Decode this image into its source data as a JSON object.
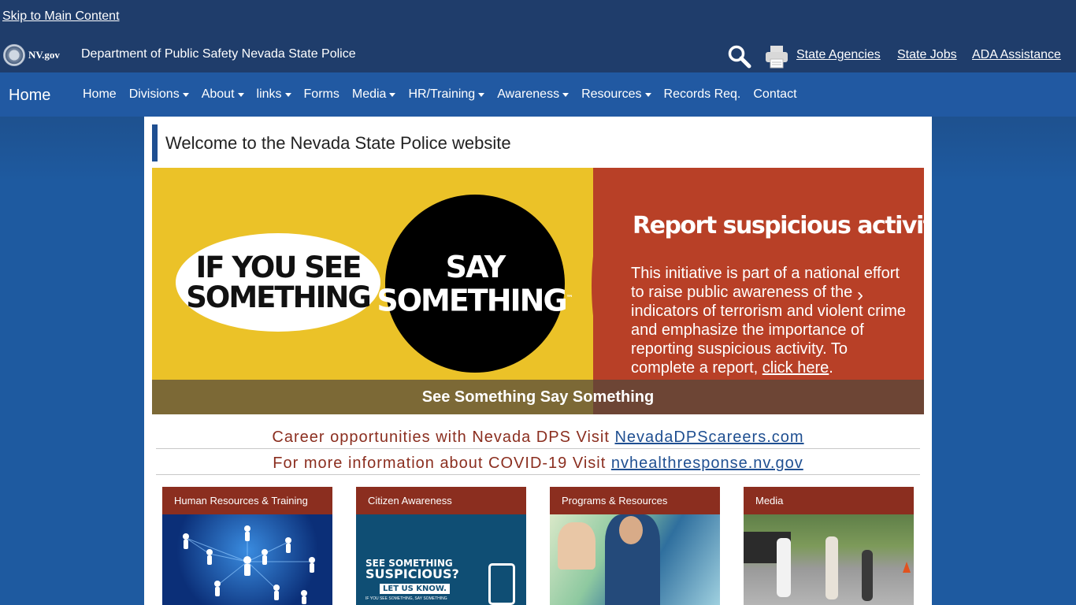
{
  "skip_link": "Skip to Main Content",
  "header": {
    "logo_text": "NV.gov",
    "department": "Department of Public Safety Nevada State Police",
    "links": [
      "State Agencies",
      "State Jobs",
      "ADA Assistance"
    ]
  },
  "nav": {
    "brand": "Home",
    "items": [
      {
        "label": "Home",
        "dropdown": false
      },
      {
        "label": "Divisions",
        "dropdown": true
      },
      {
        "label": "About",
        "dropdown": true
      },
      {
        "label": "links",
        "dropdown": true
      },
      {
        "label": "Forms",
        "dropdown": false
      },
      {
        "label": "Media",
        "dropdown": true
      },
      {
        "label": "HR/Training",
        "dropdown": true
      },
      {
        "label": "Awareness",
        "dropdown": true
      },
      {
        "label": "Resources",
        "dropdown": true
      },
      {
        "label": "Records Req.",
        "dropdown": false
      },
      {
        "label": "Contact",
        "dropdown": false
      }
    ]
  },
  "main": {
    "welcome": "Welcome to the Nevada State Police website",
    "banner": {
      "oval_line1": "IF YOU SEE",
      "oval_line2": "SOMETHING",
      "circle_line1": "SAY",
      "circle_line2": "SOMETHING",
      "circle_tm": "™",
      "report_heading": "Report suspicious activity.",
      "report_text": "This initiative is part of a national effort to raise public awareness of the indicators of terrorism and violent crime and emphasize the importance of reporting suspicious activity. To complete a report,",
      "report_link": "click here",
      "report_end": ".",
      "caption": "See Something Say Something"
    },
    "career": {
      "text": "Career opportunities with Nevada DPS Visit",
      "link": "NevadaDPScareers.com"
    },
    "covid": {
      "text": "For more information about COVID-19 Visit",
      "link": "nvhealthresponse.nv.gov"
    },
    "cards": [
      {
        "title": "Human Resources & Training"
      },
      {
        "title": "Citizen Awareness",
        "image_text1": "SEE SOMETHING",
        "image_text2": "SUSPICIOUS?",
        "image_text3": "LET US KNOW.",
        "image_text4": "IF YOU SEE SOMETHING, SAY SOMETHING"
      },
      {
        "title": "Programs & Resources"
      },
      {
        "title": "Media"
      }
    ]
  },
  "colors": {
    "topbar": "#1f3d6b",
    "nav": "#2159a2",
    "accent_red": "#8b2e1f",
    "banner_yellow": "#ebc228",
    "banner_red": "#b84027"
  },
  "icons": [
    "search-icon",
    "printer-icon",
    "nv-seal-icon",
    "next-arrow-icon",
    "caret-down-icon"
  ]
}
